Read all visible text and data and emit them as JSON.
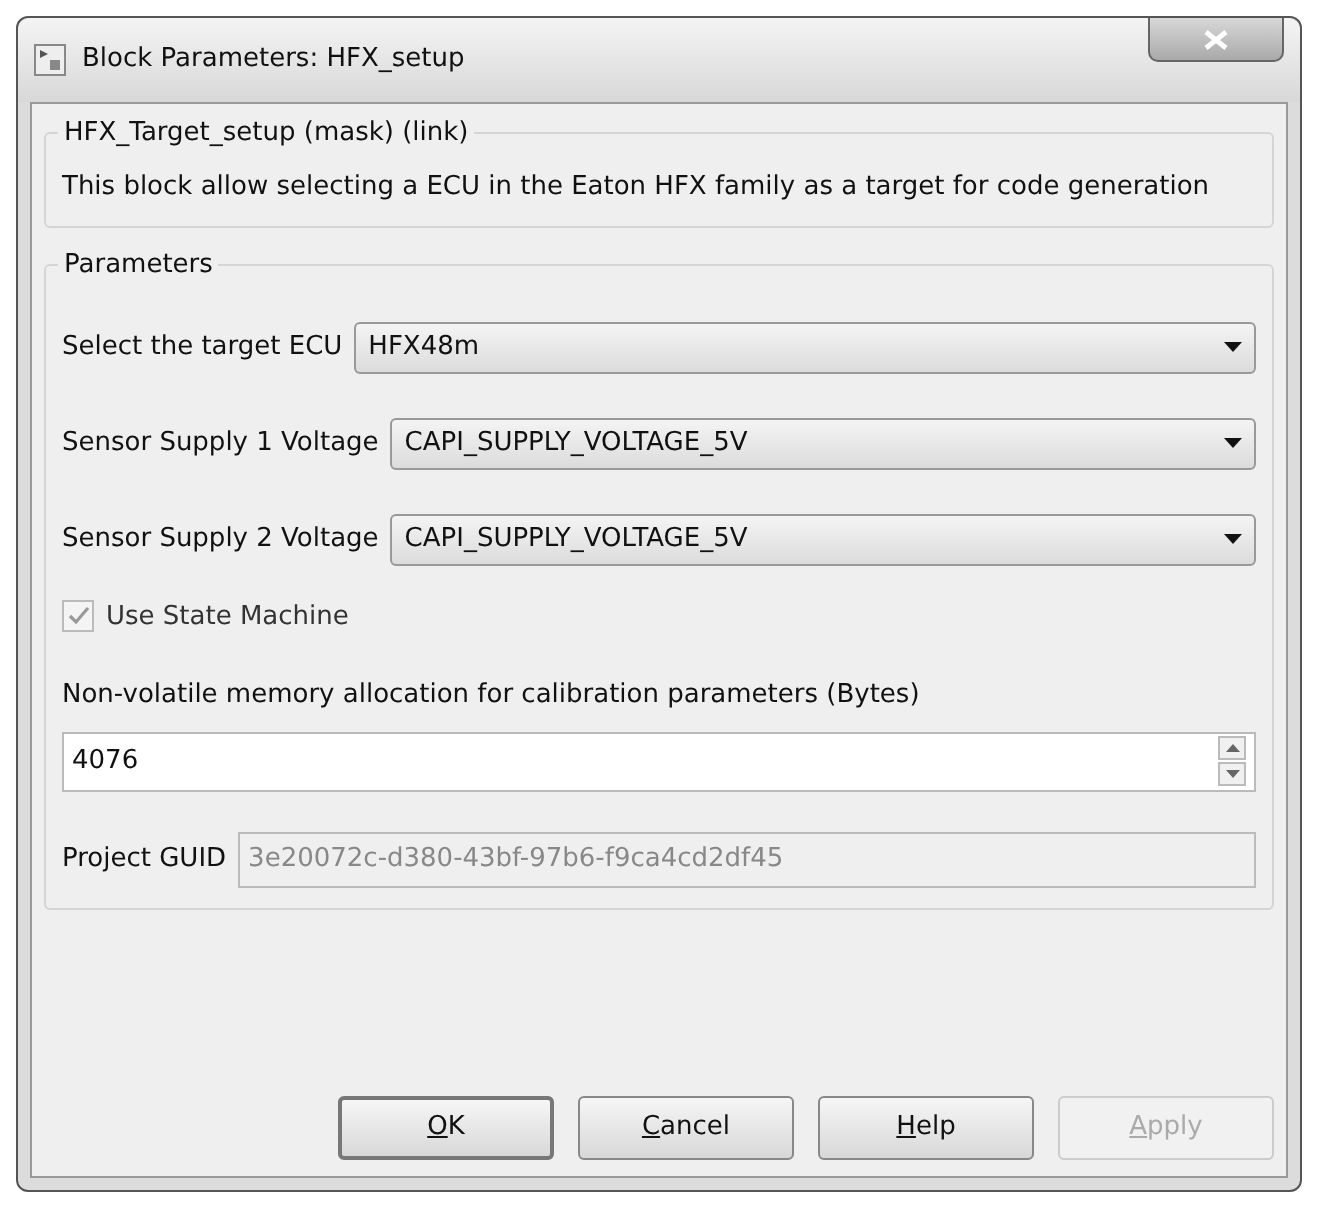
{
  "window": {
    "title": "Block Parameters: HFX_setup"
  },
  "description_group": {
    "title": "HFX_Target_setup (mask) (link)",
    "text": "This block allow selecting a ECU in the Eaton HFX family as a target for code generation"
  },
  "parameters_group": {
    "title": "Parameters",
    "dropdowns": [
      {
        "label": "Select the target ECU",
        "value": "HFX48m"
      },
      {
        "label": "Sensor Supply 1 Voltage",
        "value": "CAPI_SUPPLY_VOLTAGE_5V"
      },
      {
        "label": "Sensor Supply 2 Voltage",
        "value": "CAPI_SUPPLY_VOLTAGE_5V"
      }
    ],
    "checkbox": {
      "label": "Use State Machine",
      "checked": true,
      "disabled": true
    },
    "memory": {
      "label": "Non-volatile memory allocation for calibration parameters (Bytes)",
      "value": "4076"
    },
    "guid": {
      "label": "Project GUID",
      "value": "3e20072c-d380-43bf-97b6-f9ca4cd2df45",
      "disabled": true
    }
  },
  "buttons": [
    {
      "accel": "O",
      "rest": "K",
      "disabled": false,
      "default": true
    },
    {
      "accel": "C",
      "rest": "ancel",
      "disabled": false,
      "default": false
    },
    {
      "accel": "H",
      "rest": "elp",
      "disabled": false,
      "default": false
    },
    {
      "accel": "A",
      "rest": "pply",
      "disabled": true,
      "default": false
    }
  ]
}
